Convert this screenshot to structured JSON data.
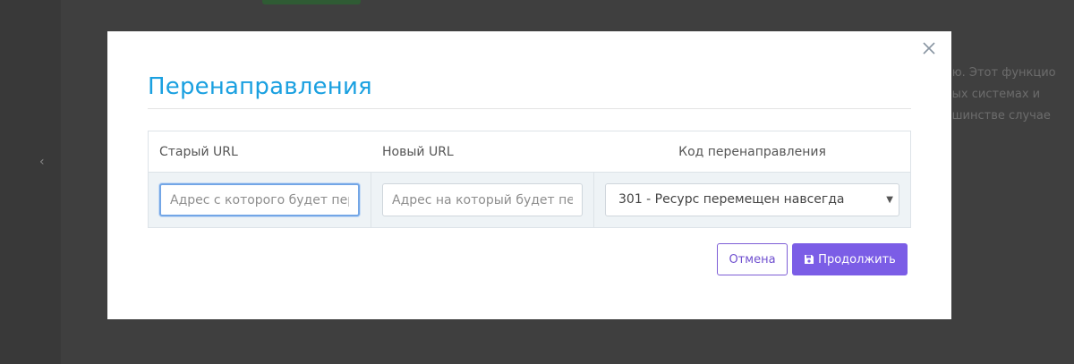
{
  "background": {
    "text_lines": [
      "ую. Этот функцио",
      "вых системах и",
      "ьшинстве случае"
    ]
  },
  "modal": {
    "title": "Перенаправления",
    "table": {
      "headers": [
        "Старый URL",
        "Новый URL",
        "Код перенаправления"
      ],
      "old_url_placeholder": "Адрес с которого будет перенаправление",
      "new_url_placeholder": "Адрес на который будет перенаправление",
      "redirect_code_value": "301 - Ресурс перемещен навсегда"
    },
    "buttons": {
      "cancel": "Отмена",
      "continue": "Продолжить"
    }
  },
  "colors": {
    "title": "#1aa0e0",
    "accent": "#7b5de6",
    "backdrop": "#3f3f3f"
  },
  "icons": [
    "close-icon",
    "save-icon",
    "chevron-left-icon",
    "caret-down-icon"
  ]
}
